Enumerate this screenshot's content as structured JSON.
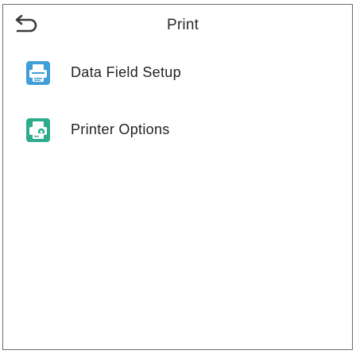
{
  "header": {
    "title": "Print",
    "back_icon": "back-arrow-icon"
  },
  "menu": {
    "items": [
      {
        "label": "Data Field Setup",
        "icon": "data-field-setup-icon"
      },
      {
        "label": "Printer Options",
        "icon": "printer-options-icon"
      }
    ]
  },
  "colors": {
    "accent": "#3f9fd6",
    "icon_blue": "#3f9fd6",
    "icon_green": "#2eac8c",
    "text": "#222222",
    "border": "#6a6a6a"
  }
}
